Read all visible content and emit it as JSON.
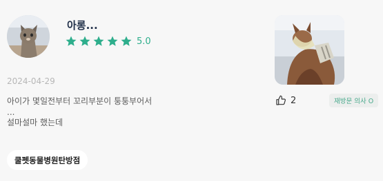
{
  "review": {
    "author": {
      "nickname": "아롱...",
      "avatar_icon": "cat-avatar-photo"
    },
    "rating": {
      "stars": 5,
      "max": 5,
      "value_label": "5.0",
      "star_color": "#2eae8c"
    },
    "date": "2024-04-29",
    "content_lines": [
      "아이가 몇일전부터 꼬리부분이 퉁퉁부어서",
      "...",
      "설마설마 했는데"
    ],
    "hospital_tag": "쿨펫동물병원탄방점",
    "photo_icon": "review-photo-cat-cone",
    "likes": {
      "count": "2",
      "icon": "thumbs-up-icon"
    },
    "revisit_badge": "재방문 의사 O"
  }
}
